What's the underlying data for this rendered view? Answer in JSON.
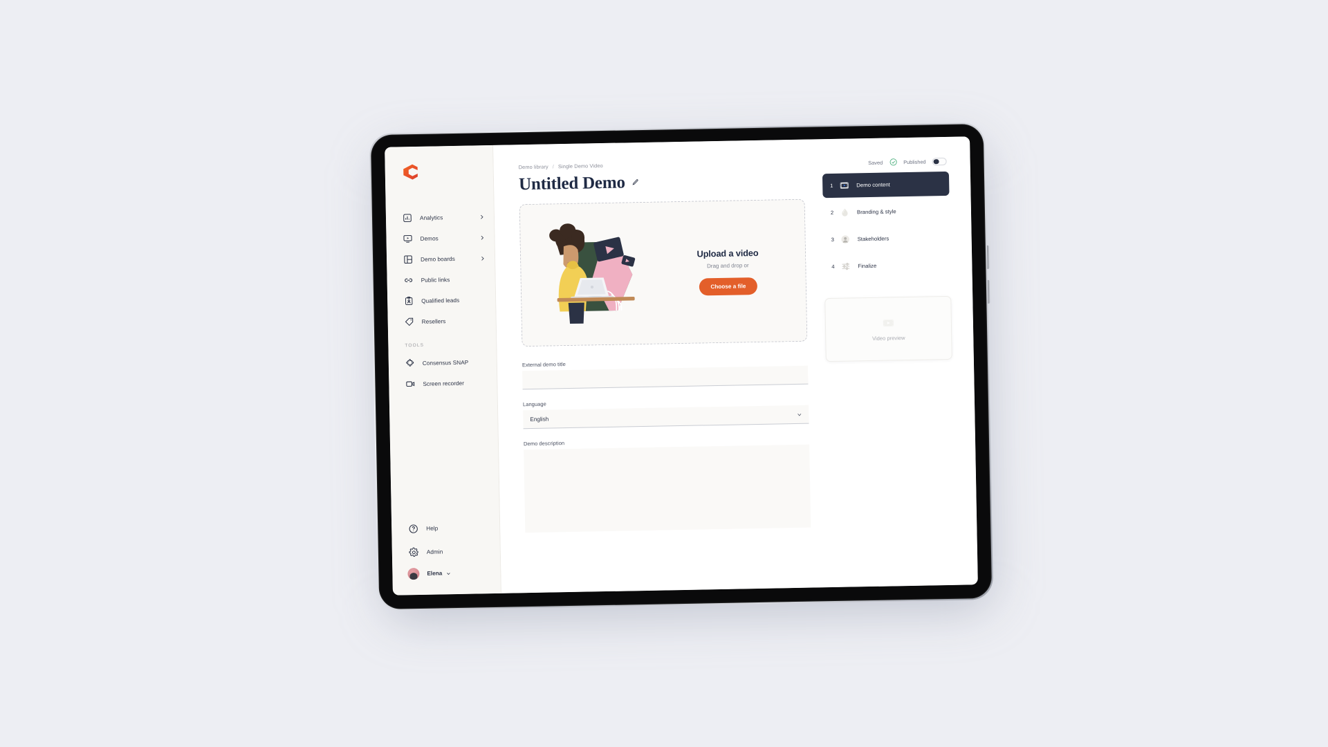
{
  "app": {
    "brand_logo": "consensus-c-logo",
    "accent_orange": "#e35f2a",
    "dark_navy": "#2b3245",
    "sidebar_bg": "#f8f7f4",
    "page_bg": "#edeef3"
  },
  "sidebar": {
    "main_items": [
      {
        "label": "Analytics",
        "icon": "bar-chart-icon",
        "has_chevron": true
      },
      {
        "label": "Demos",
        "icon": "video-monitor-icon",
        "has_chevron": true
      },
      {
        "label": "Demo boards",
        "icon": "layout-board-icon",
        "has_chevron": true
      },
      {
        "label": "Public links",
        "icon": "link-icon",
        "has_chevron": false
      },
      {
        "label": "Qualified leads",
        "icon": "clipboard-user-icon",
        "has_chevron": false
      },
      {
        "label": "Resellers",
        "icon": "tag-icon",
        "has_chevron": false
      }
    ],
    "section_title": "TOOLS",
    "tool_items": [
      {
        "label": "Consensus SNAP",
        "icon": "puzzle-piece-icon"
      },
      {
        "label": "Screen recorder",
        "icon": "video-camera-icon"
      }
    ],
    "bottom_items": [
      {
        "label": "Help",
        "icon": "question-circle-icon"
      },
      {
        "label": "Admin",
        "icon": "gear-icon"
      }
    ],
    "user": {
      "name": "Elena",
      "avatar": "user-avatar",
      "chevron": "chevron-down-icon"
    }
  },
  "header": {
    "breadcrumb": [
      {
        "label": "Demo library"
      },
      {
        "label": "Single Demo Video"
      }
    ],
    "breadcrumb_separator": "/",
    "title": "Untitled Demo",
    "edit_icon": "pencil-icon"
  },
  "status": {
    "saved_label": "Saved",
    "saved_icon": "check-circle-icon",
    "saved_color": "#4caf7d",
    "published_label": "Published",
    "published_on": false
  },
  "dropzone": {
    "heading": "Upload a video",
    "subtext": "Drag and drop or",
    "button_label": "Choose a file",
    "illustration": "person-with-laptop-illustration"
  },
  "form": {
    "title_field": {
      "label": "External demo title",
      "value": "",
      "placeholder": ""
    },
    "language_field": {
      "label": "Language",
      "value": "English",
      "chevron": "chevron-down-icon"
    },
    "description_field": {
      "label": "Demo description",
      "value": "",
      "placeholder": ""
    }
  },
  "steps": [
    {
      "num": "1",
      "label": "Demo content",
      "icon": "film-play-icon",
      "active": true
    },
    {
      "num": "2",
      "label": "Branding & style",
      "icon": "droplet-icon",
      "active": false
    },
    {
      "num": "3",
      "label": "Stakeholders",
      "icon": "user-circle-icon",
      "active": false
    },
    {
      "num": "4",
      "label": "Finalize",
      "icon": "sliders-icon",
      "active": false
    }
  ],
  "video_preview": {
    "label": "Video preview",
    "icon": "play-rect-icon"
  }
}
